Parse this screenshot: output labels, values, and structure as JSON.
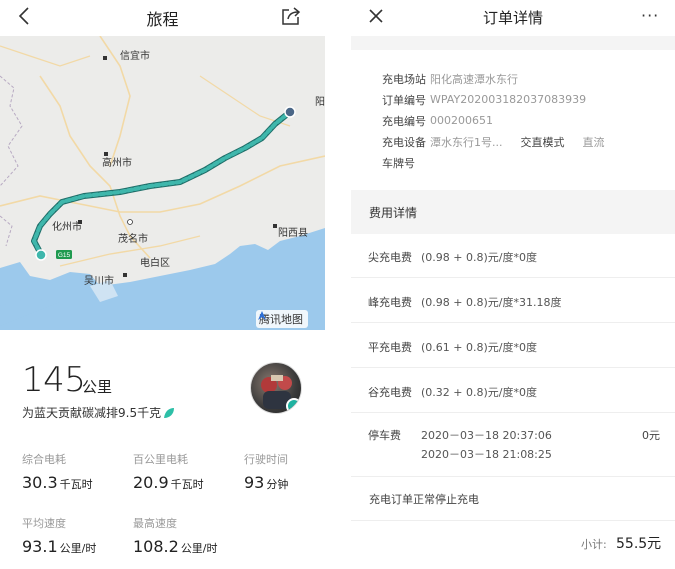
{
  "left": {
    "header": {
      "title": "旅程"
    },
    "map": {
      "cities": {
        "xinyi": "信宜市",
        "gaozhou": "高州市",
        "huazhou": "化州市",
        "maoming": "茂名市",
        "dianbai": "电白区",
        "wuchuan": "吴川市",
        "yangxi": "阳西县",
        "yang_partial": "阳"
      },
      "highway": "G15",
      "provider": "腾讯地图",
      "route_color": "#2a9d96",
      "water_color": "#9cc9ec",
      "land_color": "#ececea"
    },
    "stats": {
      "distance": "145",
      "distance_unit": "公里",
      "co2_text": "为蓝天贡献碳减排9.5千克",
      "metrics": [
        {
          "label": "综合电耗",
          "value": "30.3",
          "unit": "千瓦时"
        },
        {
          "label": "百公里电耗",
          "value": "20.9",
          "unit": "千瓦时"
        },
        {
          "label": "行驶时间",
          "value": "93",
          "unit": "分钟"
        },
        {
          "label": "平均速度",
          "value": "93.1",
          "unit": "公里/时"
        },
        {
          "label": "最高速度",
          "value": "108.2",
          "unit": "公里/时"
        }
      ]
    }
  },
  "right": {
    "header": {
      "title": "订单详情",
      "more": "···"
    },
    "info": {
      "station_label": "充电场站",
      "station_value": "阳化高速潭水东行",
      "order_label": "订单编号",
      "order_value": "WPAY202003182037083939",
      "charger_label": "充电编号",
      "charger_value": "000200651",
      "device_label": "充电设备",
      "device_value": "潭水东行1号...",
      "mode_value": "交直模式",
      "type_value": "直流",
      "plate_label": "车牌号"
    },
    "fees": {
      "title": "费用详情",
      "rows": [
        {
          "label": "尖充电费",
          "value": "(0.98 + 0.8)元/度*0度"
        },
        {
          "label": "峰充电费",
          "value": "(0.98 + 0.8)元/度*31.18度"
        },
        {
          "label": "平充电费",
          "value": "(0.61 + 0.8)元/度*0度"
        },
        {
          "label": "谷充电费",
          "value": "(0.32 + 0.8)元/度*0度"
        }
      ],
      "parking": {
        "label": "停车费",
        "start": "2020－03－18 20:37:06",
        "end": "2020－03－18 21:08:25",
        "amount": "0元"
      },
      "status": "充电订单正常停止充电",
      "subtotal_label": "小计:",
      "subtotal_value": "55.5元"
    }
  }
}
